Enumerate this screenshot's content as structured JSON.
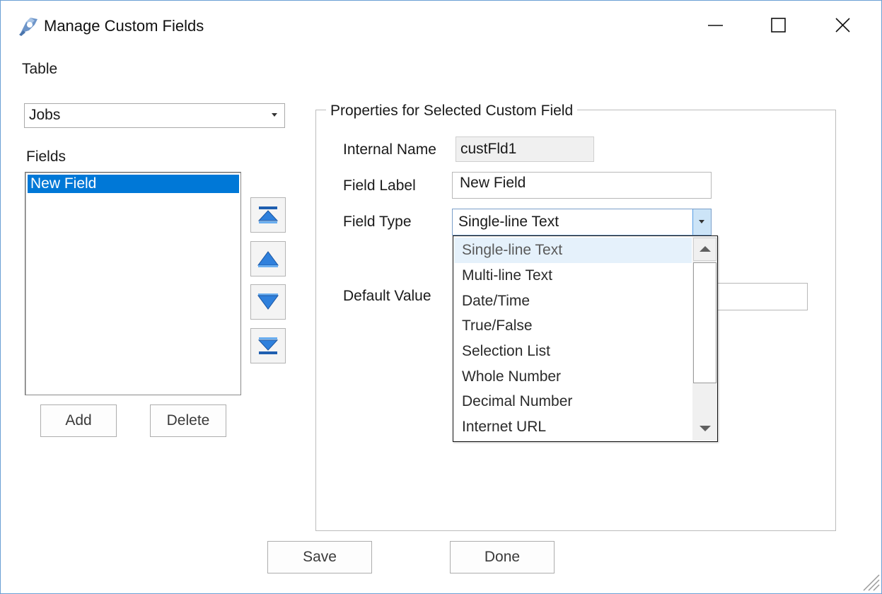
{
  "window": {
    "title": "Manage Custom Fields",
    "accent_color": "#0078d7",
    "controls": {
      "minimize_icon": "minimize-icon",
      "maximize_icon": "maximize-icon",
      "close_icon": "close-icon"
    }
  },
  "left": {
    "table_label": "Table",
    "table_select": {
      "selected": "Jobs",
      "icon": "chevron-down-icon"
    },
    "fields_label": "Fields",
    "fields_list": [
      {
        "label": "New Field",
        "selected": true
      }
    ],
    "move_buttons": [
      "move-to-top-icon",
      "move-up-icon",
      "move-down-icon",
      "move-to-bottom-icon"
    ],
    "add_label": "Add",
    "delete_label": "Delete"
  },
  "properties": {
    "group_title": "Properties for Selected Custom Field",
    "internal_name_label": "Internal Name",
    "internal_name_value": "custFld1",
    "field_label_label": "Field Label",
    "field_label_value": "New Field",
    "field_type_label": "Field Type",
    "field_type_selected": "Single-line Text",
    "default_value_label": "Default Value",
    "field_type_options": [
      "Single-line Text",
      "Multi-line Text",
      "Date/Time",
      "True/False",
      "Selection List",
      "Whole Number",
      "Decimal Number",
      "Internet URL"
    ]
  },
  "footer": {
    "save_label": "Save",
    "done_label": "Done"
  }
}
